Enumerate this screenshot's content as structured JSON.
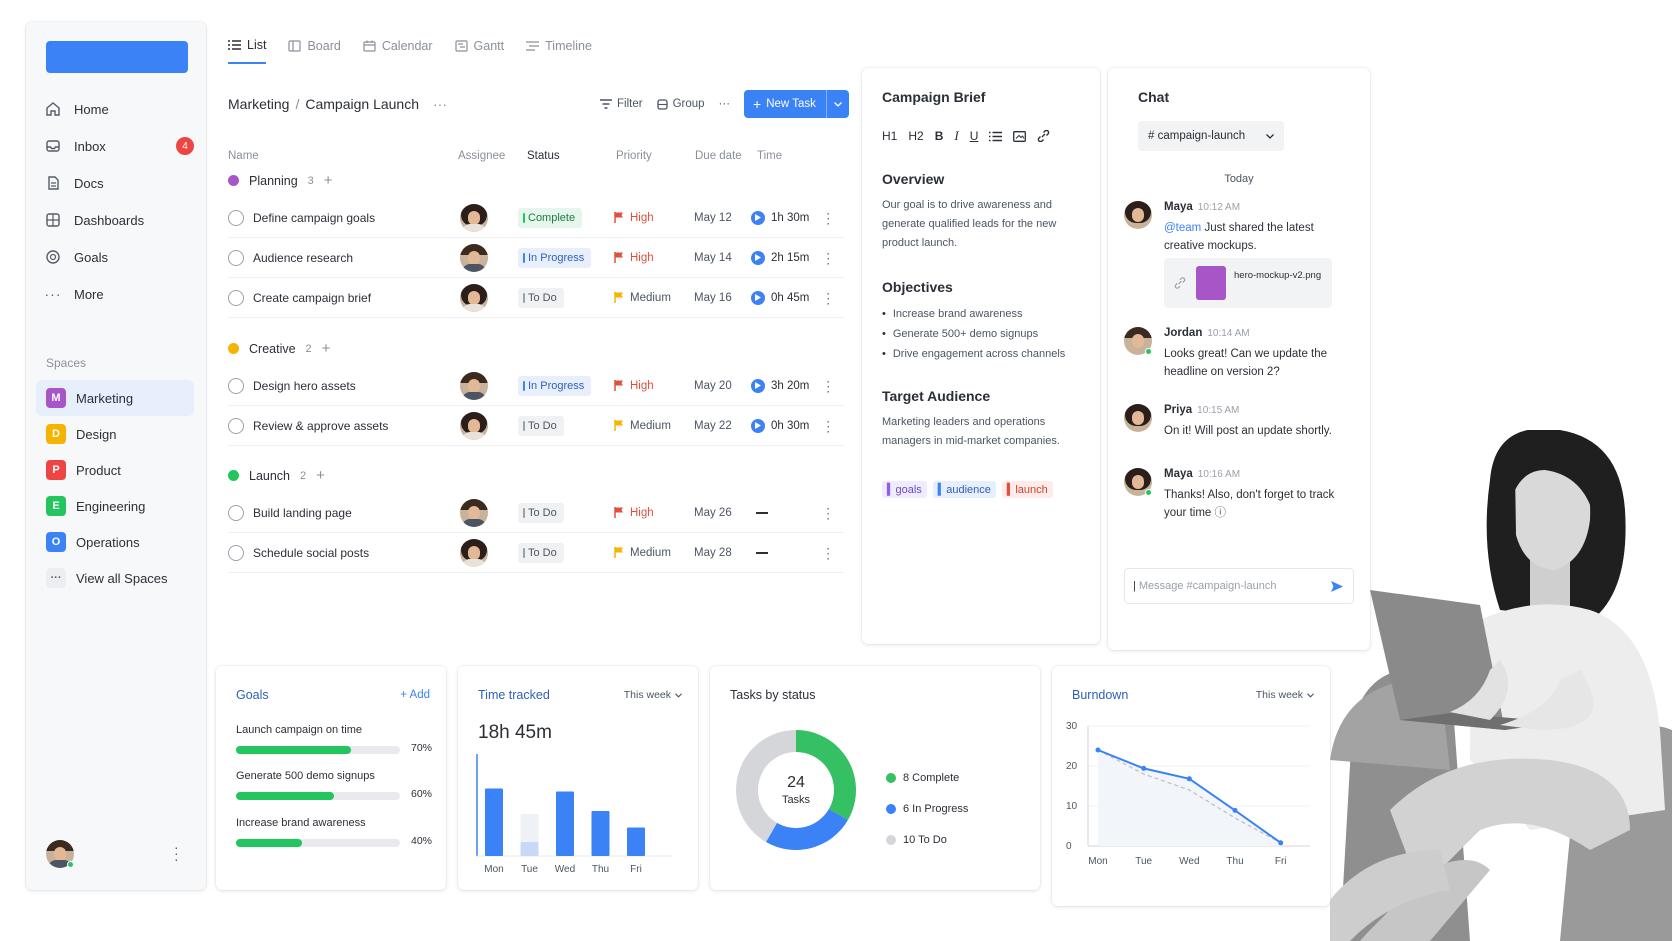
{
  "tabs": [
    {
      "label": "List",
      "icon": "list-icon"
    },
    {
      "label": "Board",
      "icon": "board-icon"
    },
    {
      "label": "Calendar",
      "icon": "calendar-icon"
    },
    {
      "label": "Gantt",
      "icon": "gantt-icon"
    },
    {
      "label": "Timeline",
      "icon": "timeline-icon"
    }
  ],
  "sidebar": {
    "nav": [
      {
        "label": "Home",
        "icon": "home-icon"
      },
      {
        "label": "Inbox",
        "icon": "inbox-icon",
        "badge": "4"
      },
      {
        "label": "Docs",
        "icon": "docs-icon"
      },
      {
        "label": "Dashboards",
        "icon": "dashboards-icon"
      },
      {
        "label": "Goals",
        "icon": "goals-icon"
      },
      {
        "label": "More",
        "icon": "more-icon"
      }
    ],
    "spaces_label": "Spaces",
    "spaces": [
      {
        "letter": "M",
        "label": "Marketing",
        "color": "#a855c7"
      },
      {
        "letter": "D",
        "label": "Design",
        "color": "#f5b400"
      },
      {
        "letter": "P",
        "label": "Product",
        "color": "#ef4444"
      },
      {
        "letter": "E",
        "label": "Engineering",
        "color": "#22c55e"
      },
      {
        "letter": "O",
        "label": "Operations",
        "color": "#3b82f6"
      }
    ],
    "view_all": "View all Spaces"
  },
  "breadcrumb": {
    "parent": "Marketing",
    "separator": "/",
    "current": "Campaign Launch"
  },
  "toolbar": {
    "filter": "Filter",
    "group": "Group",
    "new_task": "New Task"
  },
  "columns": {
    "name": "Name",
    "assignee": "Assignee",
    "status": "Status",
    "priority": "Priority",
    "due": "Due date",
    "time": "Time"
  },
  "groups": [
    {
      "name": "Planning",
      "count": "3",
      "color": "#a855c7",
      "tasks": [
        {
          "name": "Define campaign goals",
          "status": "Complete",
          "priority": "High",
          "due": "May 12",
          "time": "1h 30m",
          "assignee_gender": "f"
        },
        {
          "name": "Audience research",
          "status": "In Progress",
          "priority": "High",
          "due": "May 14",
          "time": "2h 15m",
          "assignee_gender": "m"
        },
        {
          "name": "Create campaign brief",
          "status": "To Do",
          "priority": "Medium",
          "due": "May 16",
          "time": "0h 45m",
          "assignee_gender": "f"
        }
      ]
    },
    {
      "name": "Creative",
      "count": "2",
      "color": "#f5b400",
      "tasks": [
        {
          "name": "Design hero assets",
          "status": "In Progress",
          "priority": "High",
          "due": "May 20",
          "time": "3h 20m",
          "assignee_gender": "m"
        },
        {
          "name": "Review & approve assets",
          "status": "To Do",
          "priority": "Medium",
          "due": "May 22",
          "time": "0h 30m",
          "assignee_gender": "f"
        }
      ]
    },
    {
      "name": "Launch",
      "count": "2",
      "color": "#22c55e",
      "tasks": [
        {
          "name": "Build landing page",
          "status": "To Do",
          "priority": "High",
          "due": "May 26",
          "time": "",
          "assignee_gender": "m"
        },
        {
          "name": "Schedule social posts",
          "status": "To Do",
          "priority": "Medium",
          "due": "May 28",
          "time": "",
          "assignee_gender": "f"
        }
      ]
    }
  ],
  "brief": {
    "title": "Campaign Brief",
    "overview_title": "Overview",
    "overview_text": "Our goal is to drive awareness and generate qualified leads for the new product launch.",
    "objectives_title": "Objectives",
    "objectives": [
      "Increase brand awareness",
      "Generate 500+ demo signups",
      "Drive engagement across channels"
    ],
    "audience_title": "Target Audience",
    "audience_text": "Marketing leaders and operations managers in mid-market companies.",
    "tags": [
      {
        "label": "goals",
        "color": "#8b5cf6",
        "bg": "#f1ecfd"
      },
      {
        "label": "audience",
        "color": "#2f5fb8",
        "bg": "#e7effc"
      },
      {
        "label": "launch",
        "color": "#e2503d",
        "bg": "#fdecea"
      }
    ]
  },
  "chat": {
    "title": "Chat",
    "channel": "# campaign-launch",
    "day": "Today",
    "messages": [
      {
        "author": "Maya",
        "time": "10:12 AM",
        "mention": "@team",
        "text": "Just shared the latest creative mockups."
      },
      {
        "author": "Jordan",
        "time": "10:14 AM",
        "text": "Looks great! Can we update the headline on version 2?"
      },
      {
        "author": "Priya",
        "time": "10:15 AM",
        "text": "On it! Will post an update shortly."
      },
      {
        "author": "Maya",
        "time": "10:16 AM",
        "text": "Thanks! Also, don't forget to track your time"
      }
    ],
    "attachment": "hero-mockup-v2.png",
    "input_placeholder": "Message #campaign-launch"
  },
  "goals_widget": {
    "title": "Goals",
    "add": "+ Add",
    "items": [
      {
        "label": "Launch campaign on time",
        "pct": "70%",
        "value": 0.7
      },
      {
        "label": "Generate 500 demo signups",
        "pct": "60%",
        "value": 0.6
      },
      {
        "label": "Increase brand awareness",
        "pct": "40%",
        "value": 0.4
      }
    ]
  },
  "time_widget": {
    "title": "Time tracked",
    "range": "This week",
    "total": "18h 45m"
  },
  "status_widget": {
    "title": "Tasks by status",
    "center_value": "24",
    "center_label": "Tasks",
    "legend": [
      {
        "label": "8 Complete",
        "color": "#34c063"
      },
      {
        "label": "6 In Progress",
        "color": "#3b82f6"
      },
      {
        "label": "10 To Do",
        "color": "#d4d6da"
      }
    ]
  },
  "burndown_widget": {
    "title": "Burndown",
    "range": "This week"
  },
  "chart_data": [
    {
      "type": "bar",
      "categories": [
        "Mon",
        "Tue",
        "Wed",
        "Thu",
        "Fri"
      ],
      "series": [
        {
          "values": [
            4.5,
            2.8,
            4.3,
            3.0,
            1.9
          ]
        }
      ],
      "colors": [
        "#3b82f6",
        "#dbe7fb",
        "#3b82f6",
        "#3b82f6",
        "#3b82f6"
      ]
    },
    {
      "type": "pie",
      "categories": [
        "Complete",
        "In Progress",
        "To Do"
      ],
      "values": [
        8,
        6,
        10
      ]
    },
    {
      "type": "line",
      "x": [
        "Mon",
        "Tue",
        "Wed",
        "Thu",
        "Fri"
      ],
      "ylim": [
        0,
        30
      ],
      "yticks": [
        0,
        10,
        20,
        30
      ],
      "series": [
        {
          "values": [
            24,
            19.4,
            16.8,
            8.9,
            0.8
          ]
        },
        {
          "values": [
            24,
            18,
            14,
            7,
            0.8
          ]
        }
      ]
    }
  ]
}
